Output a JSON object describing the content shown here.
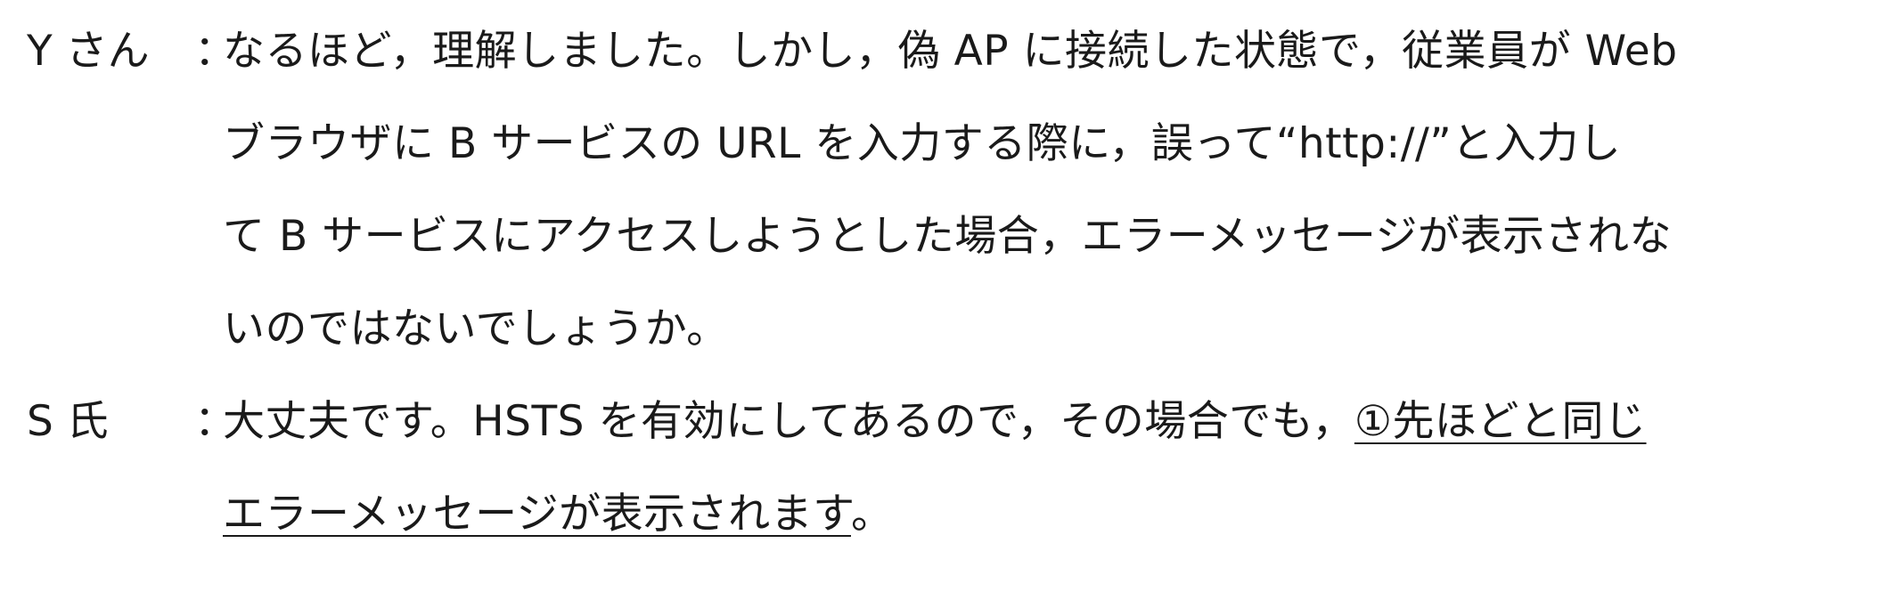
{
  "dialogue": {
    "y_speaker": "Y さん",
    "y_colon": "：",
    "y_lines": [
      "なるほど，理解しました。しかし，偽 AP に接続した状態で，従業員が Web",
      "ブラウザに B サービスの URL を入力する際に，誤って“http://”と入力し",
      "て B サービスにアクセスしようとした場合，エラーメッセージが表示されな",
      "いのではないでしょうか。"
    ],
    "s_speaker": "S 氏",
    "s_colon": "：",
    "s_line1_plain": "大丈夫です。HSTS を有効にしてあるので，その場合でも，",
    "s_line1_underlined": "①先ほどと同じ",
    "s_line2_underlined": "エラーメッセージが表示されます",
    "s_line2_end": "。"
  }
}
